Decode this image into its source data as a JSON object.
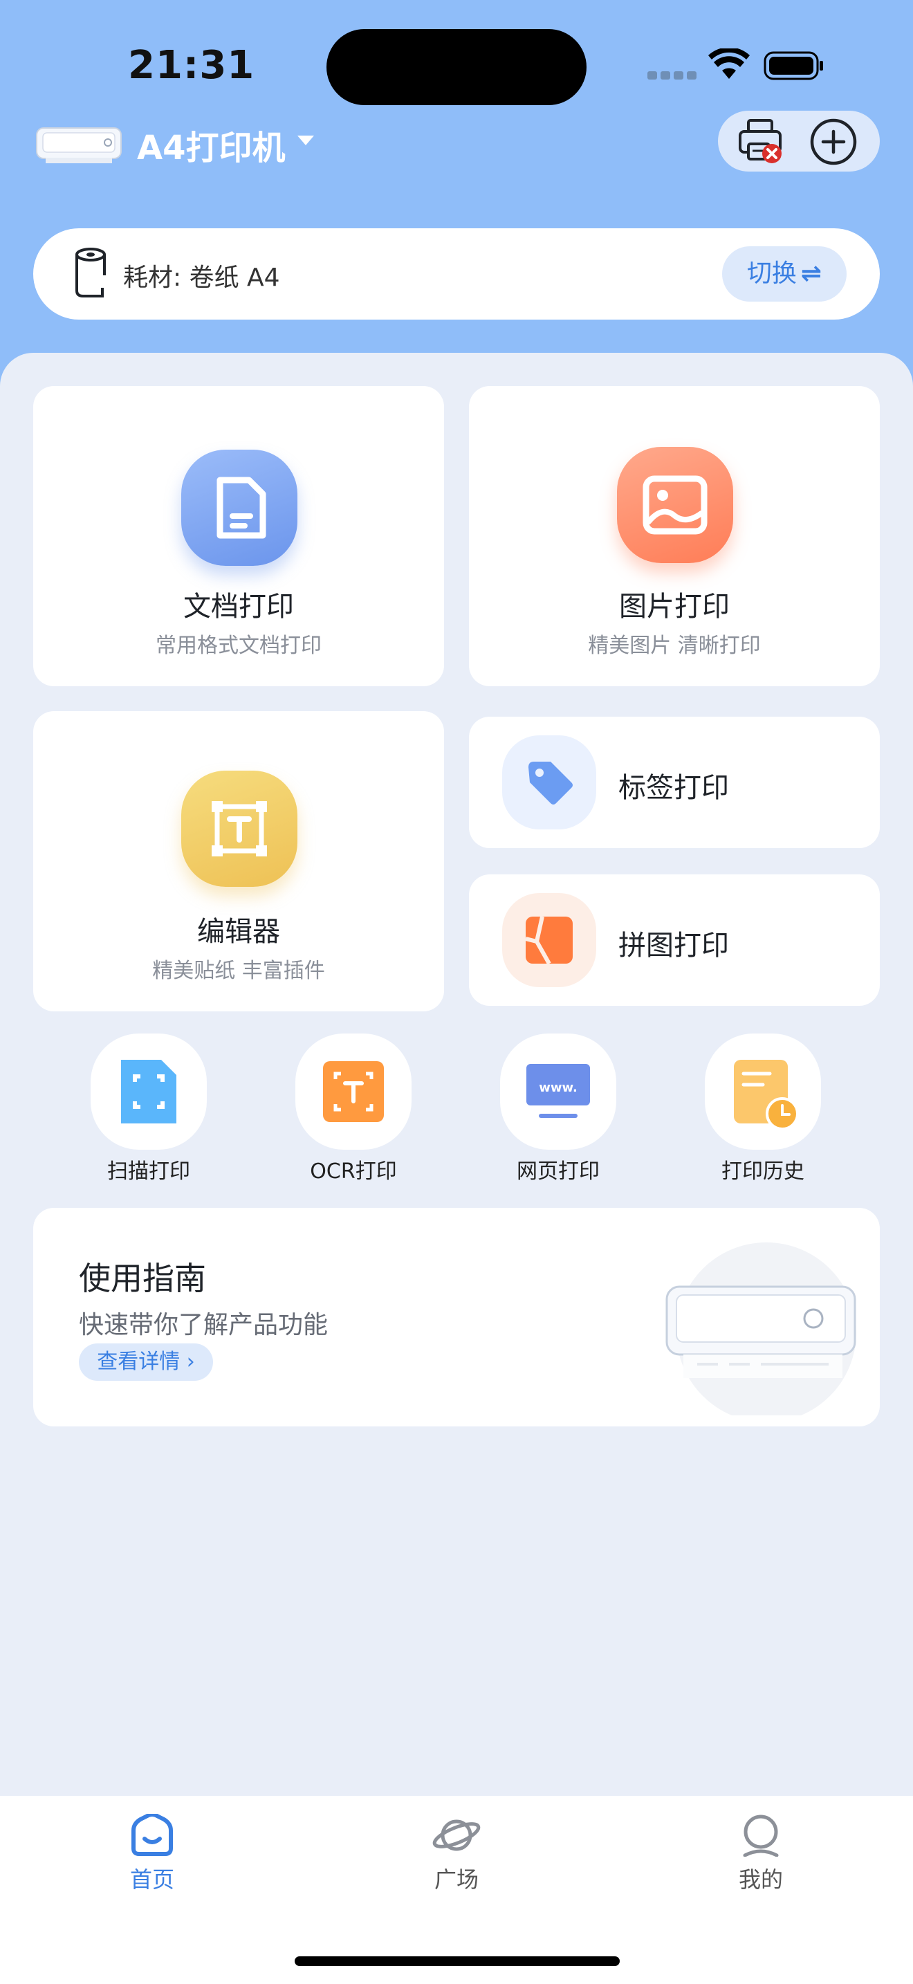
{
  "status_bar": {
    "time": "21:31"
  },
  "header": {
    "printer_name": "A4打印机"
  },
  "consumable": {
    "label": "耗材:  卷纸 A4",
    "switch_label": "切换"
  },
  "cards": {
    "doc": {
      "title": "文档打印",
      "subtitle": "常用格式文档打印"
    },
    "image": {
      "title": "图片打印",
      "subtitle": "精美图片 清晰打印"
    },
    "editor": {
      "title": "编辑器",
      "subtitle": "精美贴纸 丰富插件"
    },
    "label": {
      "title": "标签打印"
    },
    "collage": {
      "title": "拼图打印"
    }
  },
  "tools": [
    {
      "label": "扫描打印",
      "icon": "scan-icon"
    },
    {
      "label": "OCR打印",
      "icon": "ocr-icon"
    },
    {
      "label": "网页打印",
      "icon": "web-icon"
    },
    {
      "label": "打印历史",
      "icon": "history-icon"
    }
  ],
  "guide": {
    "title": "使用指南",
    "subtitle": "快速带你了解产品功能",
    "button": "查看详情"
  },
  "tabs": [
    {
      "label": "首页",
      "icon": "home-icon",
      "active": true
    },
    {
      "label": "广场",
      "icon": "planet-icon",
      "active": false
    },
    {
      "label": "我的",
      "icon": "profile-icon",
      "active": false
    }
  ],
  "colors": {
    "accent": "#3a7fe2",
    "header_bg": "#8fbdf9",
    "page_bg": "#e9eef8"
  }
}
